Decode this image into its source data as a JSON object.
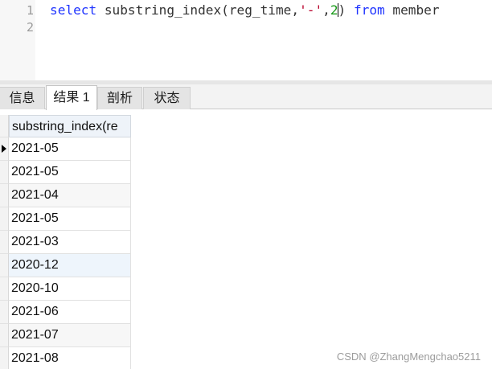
{
  "editor": {
    "line_numbers": [
      "1",
      "2"
    ],
    "code": {
      "kw_select": "select",
      "fn_text": " substring_index(reg_time,",
      "str_dash": "'-'",
      "comma": ",",
      "num_two": "2",
      "close_paren": ")",
      "kw_from": "from",
      "table": " member"
    }
  },
  "tabs": [
    {
      "label": "信息",
      "active": false
    },
    {
      "label": "结果 1",
      "active": true
    },
    {
      "label": "剖析",
      "active": false
    },
    {
      "label": "状态",
      "active": false
    }
  ],
  "grid": {
    "columns": [
      "substring_index(re"
    ],
    "rows": [
      "2021-05",
      "2021-05",
      "2021-04",
      "2021-05",
      "2021-03",
      "2020-12",
      "2020-10",
      "2021-06",
      "2021-07",
      "2021-08"
    ]
  },
  "watermark": "CSDN @ZhangMengchao5211"
}
